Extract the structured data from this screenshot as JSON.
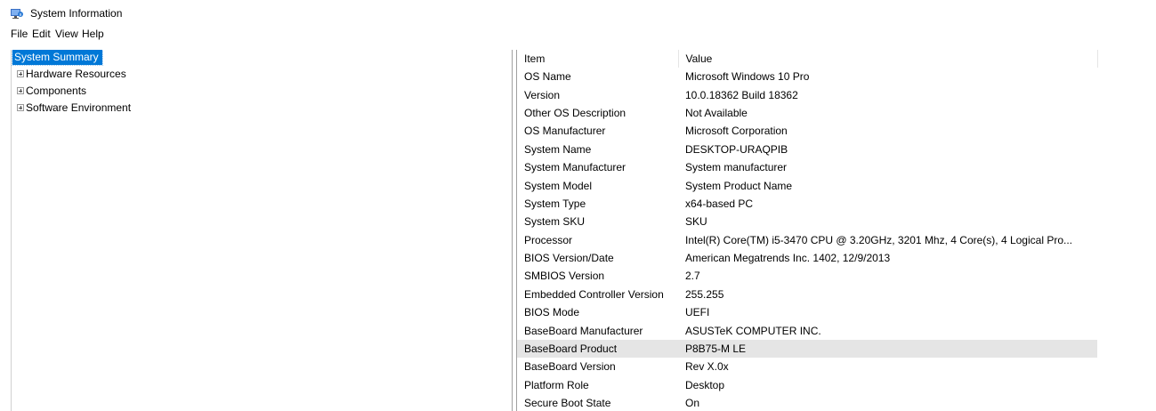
{
  "window": {
    "title": "System Information",
    "icon": "system-information-icon"
  },
  "menu": {
    "items": [
      "File",
      "Edit",
      "View",
      "Help"
    ]
  },
  "tree": {
    "root": "System Summary",
    "children": [
      {
        "label": "Hardware Resources",
        "icon": "expand-plus-icon"
      },
      {
        "label": "Components",
        "icon": "expand-plus-icon"
      },
      {
        "label": "Software Environment",
        "icon": "expand-plus-icon"
      }
    ]
  },
  "table": {
    "columns": [
      "Item",
      "Value"
    ],
    "selected_row": "BaseBoard Product",
    "rows": [
      {
        "item": "OS Name",
        "value": "Microsoft Windows 10 Pro"
      },
      {
        "item": "Version",
        "value": "10.0.18362 Build 18362"
      },
      {
        "item": "Other OS Description",
        "value": "Not Available"
      },
      {
        "item": "OS Manufacturer",
        "value": "Microsoft Corporation"
      },
      {
        "item": "System Name",
        "value": "DESKTOP-URAQPIB"
      },
      {
        "item": "System Manufacturer",
        "value": "System manufacturer"
      },
      {
        "item": "System Model",
        "value": "System Product Name"
      },
      {
        "item": "System Type",
        "value": "x64-based PC"
      },
      {
        "item": "System SKU",
        "value": "SKU"
      },
      {
        "item": "Processor",
        "value": "Intel(R) Core(TM) i5-3470 CPU @ 3.20GHz, 3201 Mhz, 4 Core(s), 4 Logical Pro..."
      },
      {
        "item": "BIOS Version/Date",
        "value": "American Megatrends Inc. 1402, 12/9/2013"
      },
      {
        "item": "SMBIOS Version",
        "value": "2.7"
      },
      {
        "item": "Embedded Controller Version",
        "value": "255.255"
      },
      {
        "item": "BIOS Mode",
        "value": "UEFI"
      },
      {
        "item": "BaseBoard Manufacturer",
        "value": "ASUSTeK COMPUTER INC."
      },
      {
        "item": "BaseBoard Product",
        "value": "P8B75-M LE"
      },
      {
        "item": "BaseBoard Version",
        "value": "Rev X.0x"
      },
      {
        "item": "Platform Role",
        "value": "Desktop"
      },
      {
        "item": "Secure Boot State",
        "value": "On"
      }
    ]
  },
  "colors": {
    "selection_blue": "#0078d7",
    "row_highlight": "#e5e5e5"
  }
}
